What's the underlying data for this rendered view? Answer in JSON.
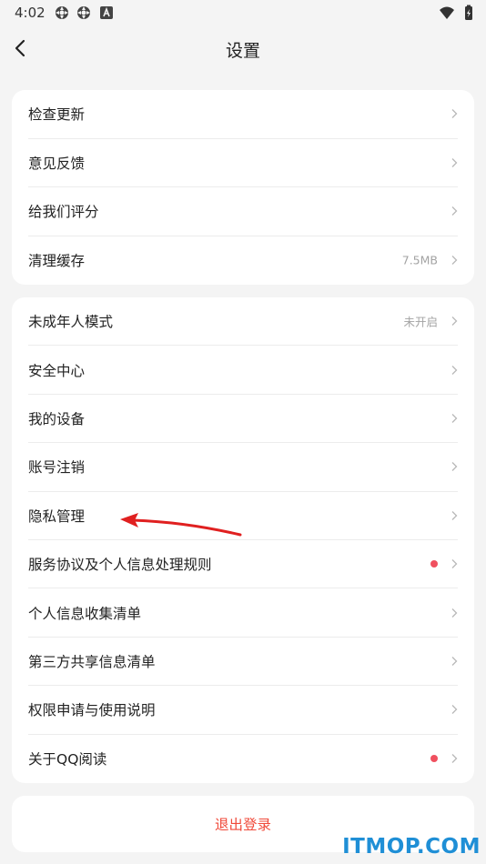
{
  "status_bar": {
    "time": "4:02",
    "left_icons": [
      "settings-gear-icon",
      "settings-gear-icon",
      "font-a-icon"
    ],
    "right_icons": [
      "wifi-icon",
      "battery-charging-icon"
    ]
  },
  "header": {
    "title": "设置",
    "back_icon": "chevron-left-icon"
  },
  "group1": [
    {
      "label": "检查更新"
    },
    {
      "label": "意见反馈"
    },
    {
      "label": "给我们评分"
    },
    {
      "label": "清理缓存",
      "value": "7.5MB"
    }
  ],
  "group2": [
    {
      "label": "未成年人模式",
      "value": "未开启"
    },
    {
      "label": "安全中心"
    },
    {
      "label": "我的设备"
    },
    {
      "label": "账号注销"
    },
    {
      "label": "隐私管理"
    },
    {
      "label": "服务协议及个人信息处理规则",
      "badge": "dot"
    },
    {
      "label": "个人信息收集清单"
    },
    {
      "label": "第三方共享信息清单"
    },
    {
      "label": "权限申请与使用说明"
    },
    {
      "label": "关于QQ阅读",
      "badge": "dot"
    }
  ],
  "logout": {
    "label": "退出登录"
  },
  "watermark": "ITMOP.COM",
  "colors": {
    "background": "#f4f4f4",
    "card": "#ffffff",
    "logout_text": "#f04a3a",
    "badge_dot": "#f0505f",
    "annotation_arrow": "#e02020",
    "watermark": "#1f8fd6"
  }
}
